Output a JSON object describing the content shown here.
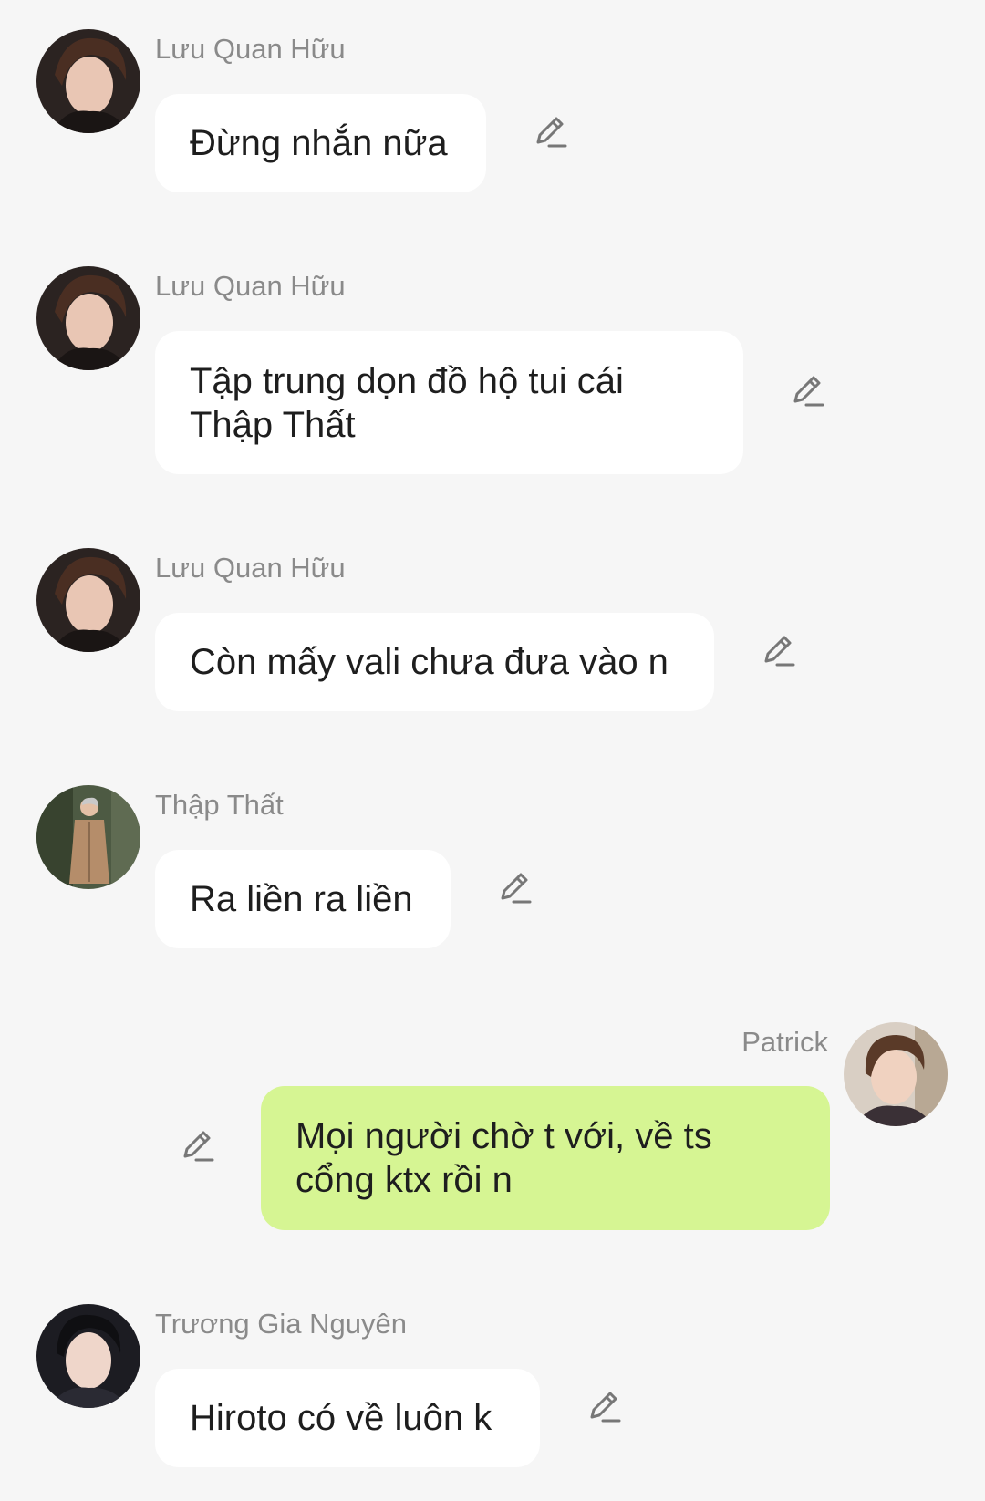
{
  "messages": [
    {
      "sender": "Lưu Quan Hữu",
      "text": "Đừng nhắn nữa",
      "side": "left",
      "avatar": "avatar-dark-hair-boy"
    },
    {
      "sender": "Lưu Quan Hữu",
      "text": "Tập trung dọn đồ hộ tui cái Thập Thất",
      "side": "left",
      "avatar": "avatar-dark-hair-boy"
    },
    {
      "sender": "Lưu Quan Hữu",
      "text": "Còn mấy vali chưa đưa vào n",
      "side": "left",
      "avatar": "avatar-dark-hair-boy"
    },
    {
      "sender": "Thập Thất",
      "text": "Ra liền ra liền",
      "side": "left",
      "avatar": "avatar-trenchcoat-outdoor"
    },
    {
      "sender": "Patrick",
      "text": "Mọi người chờ t với, về ts cổng ktx rồi n",
      "side": "right",
      "avatar": "avatar-brown-hair-boy"
    },
    {
      "sender": "Trương Gia Nguyên",
      "text": "Hiroto có về luôn k",
      "side": "left",
      "avatar": "avatar-black-hair-boy"
    }
  ],
  "icons": {
    "edit": "pencil-edit-icon"
  },
  "colors": {
    "background": "#f6f6f6",
    "bubble_other": "#ffffff",
    "bubble_mine": "#d6f593",
    "sender_name": "#8a8a8a",
    "text": "#1e1e1e",
    "icon": "#777777"
  }
}
